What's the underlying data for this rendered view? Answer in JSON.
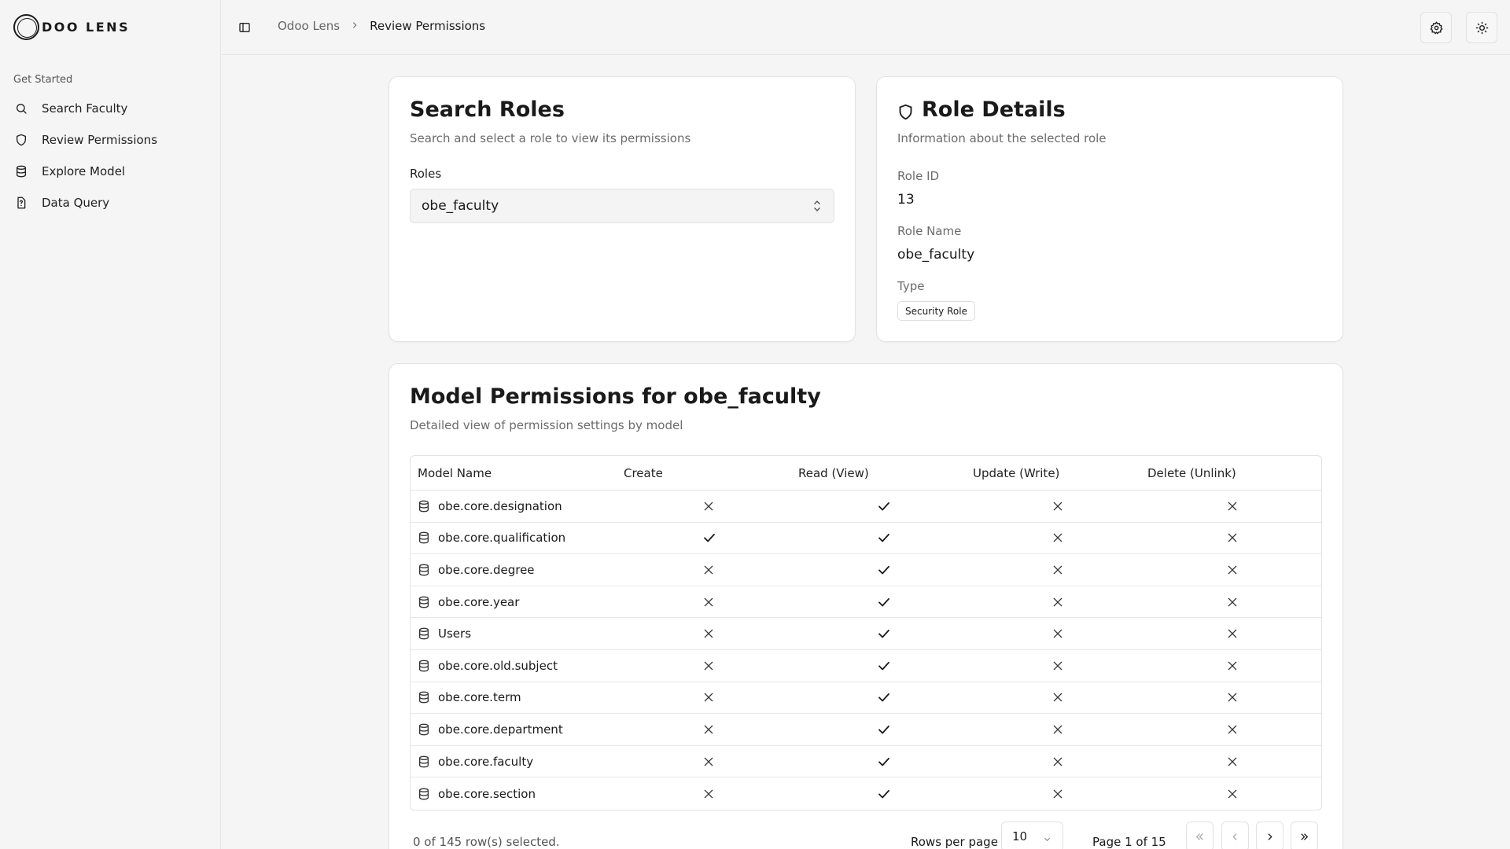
{
  "app": {
    "logo_text": "DOO LENS"
  },
  "sidebar": {
    "group_label": "Get Started",
    "items": [
      {
        "label": "Search Faculty",
        "icon": "search-icon"
      },
      {
        "label": "Review Permissions",
        "icon": "shield-icon",
        "active": true
      },
      {
        "label": "Explore Model",
        "icon": "database-icon"
      },
      {
        "label": "Data Query",
        "icon": "file-question-icon"
      }
    ]
  },
  "breadcrumb": {
    "root": "Odoo Lens",
    "current": "Review Permissions"
  },
  "search_roles": {
    "title": "Search Roles",
    "description": "Search and select a role to view its permissions",
    "field_label": "Roles",
    "selected": "obe_faculty"
  },
  "role_details": {
    "title": "Role Details",
    "description": "Information about the selected role",
    "id_label": "Role ID",
    "id_value": "13",
    "name_label": "Role Name",
    "name_value": "obe_faculty",
    "type_label": "Type",
    "type_value": "Security Role"
  },
  "permissions": {
    "title": "Model Permissions for obe_faculty",
    "description": "Detailed view of permission settings by model",
    "columns": [
      "Model Name",
      "Create",
      "Read (View)",
      "Update (Write)",
      "Delete (Unlink)"
    ],
    "rows": [
      {
        "model": "obe.core.designation",
        "create": false,
        "read": true,
        "update": false,
        "delete": false
      },
      {
        "model": "obe.core.qualification",
        "create": true,
        "read": true,
        "update": false,
        "delete": false
      },
      {
        "model": "obe.core.degree",
        "create": false,
        "read": true,
        "update": false,
        "delete": false
      },
      {
        "model": "obe.core.year",
        "create": false,
        "read": true,
        "update": false,
        "delete": false
      },
      {
        "model": "Users",
        "create": false,
        "read": true,
        "update": false,
        "delete": false
      },
      {
        "model": "obe.core.old.subject",
        "create": false,
        "read": true,
        "update": false,
        "delete": false
      },
      {
        "model": "obe.core.term",
        "create": false,
        "read": true,
        "update": false,
        "delete": false
      },
      {
        "model": "obe.core.department",
        "create": false,
        "read": true,
        "update": false,
        "delete": false
      },
      {
        "model": "obe.core.faculty",
        "create": false,
        "read": true,
        "update": false,
        "delete": false
      },
      {
        "model": "obe.core.section",
        "create": false,
        "read": true,
        "update": false,
        "delete": false
      }
    ],
    "selection_text": "0 of 145 row(s) selected.",
    "rows_per_page_label": "Rows per page",
    "rows_per_page_value": "10",
    "page_text": "Page 1 of 15"
  }
}
